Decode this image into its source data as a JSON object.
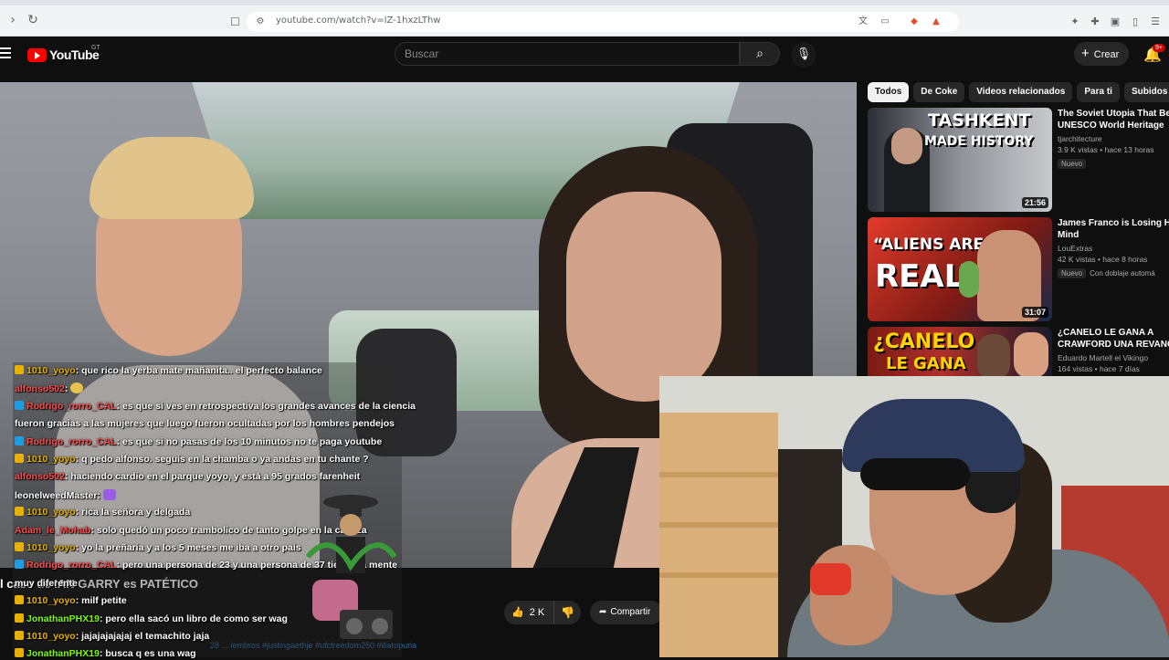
{
  "browser": {
    "url": "youtube.com/watch?v=lZ-1hxzLThw"
  },
  "header": {
    "logo_text": "YouTube",
    "logo_country": "GT",
    "search_placeholder": "Buscar",
    "create_label": "Crear",
    "notif_count": "9+"
  },
  "video": {
    "title": "l caso de IAN GARRY es PATÉTICO",
    "likes": "2 K",
    "share_label": "Compartir",
    "hashtags": "28 ... iembros #justingaethje #ufcfreedom250 #iliatopuria"
  },
  "chips": [
    "Todos",
    "De Coke",
    "Videos relacionados",
    "Para ti",
    "Subidos re"
  ],
  "recommendations": [
    {
      "title": "The Soviet Utopia That Beca",
      "title2": "UNESCO World Heritage",
      "channel": "tjarchitecture",
      "meta": "3.9 K vistas • hace 13 horas",
      "badge": "Nuevo",
      "duration": "21:56",
      "thumb_text1": "TASHKENT",
      "thumb_text2": "MADE HISTORY"
    },
    {
      "title": "James Franco is Losing His",
      "title2": "Mind",
      "channel": "LouExtras",
      "meta": "42 K vistas • hace 8 horas",
      "badge": "Nuevo",
      "extra": "Con doblaje automá",
      "duration": "31:07",
      "thumb_text1": "“ALIENS ARE",
      "thumb_text2": "REAL”"
    },
    {
      "title": "¿CANELO LE GANA A",
      "title2": "CRAWFORD UNA REVANCH",
      "channel": "Eduardo Martell el Vikingo",
      "meta": "164 vistas • hace 7 días",
      "thumb_text1": "¿CANELO",
      "thumb_text2": "LE GANA"
    }
  ],
  "chat": [
    {
      "user": "1010_yoyo",
      "msg": ": que rico la yerba mate mañanita.. el perfecto balance",
      "color": "#e8b100",
      "badge": "sub"
    },
    {
      "user": "alfonso502",
      "msg": ":",
      "color": "#ff4d4d",
      "badge": "none",
      "emote": "yellow"
    },
    {
      "user": "Rodrigo_rorro_CAL",
      "msg": ": es que si ves en retrospectiva los grandes avances de la ciencia",
      "color": "#ff4d4d",
      "badge": "tw"
    },
    {
      "user": "",
      "msg": "fueron gracias a las mujeres que luego fueron ocultadas por los hombres pendejos",
      "color": "#fff",
      "badge": "none"
    },
    {
      "user": "Rodrigo_rorro_CAL",
      "msg": ": es que si no pasas de los 10 minutos no te paga youtube",
      "color": "#ff4d4d",
      "badge": "tw"
    },
    {
      "user": "1010_yoyo",
      "msg": ": q pedo alfonso. seguis en la chamba o ya andas en tu chante ?",
      "color": "#e8b100",
      "badge": "sub"
    },
    {
      "user": "alfonso502",
      "msg": ": haciendo cardio en el parque yoyo, y está a 95 grados farenheit",
      "color": "#ff4d4d",
      "badge": "none"
    },
    {
      "user": "leonelweedMaster",
      "msg": ":",
      "color": "#ffffff",
      "badge": "none",
      "emote": "purple"
    },
    {
      "user": "1010_yoyo",
      "msg": ": rica la señora y delgada",
      "color": "#e8b100",
      "badge": "sub"
    },
    {
      "user": "Adam_le_Mohab",
      "msg": ": solo quedó un poco trambolico de tanto golpe en la cabeza",
      "color": "#ff4d4d",
      "badge": "none"
    },
    {
      "user": "1010_yoyo",
      "msg": ": yo la preñaria y a los 5 meses me iba a otro pais",
      "color": "#e8b100",
      "badge": "sub"
    },
    {
      "user": "Rodrigo_rorro_CAL",
      "msg": ": pero una persona de 23 y una persona de 37 tienen la mente",
      "color": "#ff4d4d",
      "badge": "tw"
    },
    {
      "user": "",
      "msg": "muy diferente",
      "color": "#fff",
      "badge": "none"
    },
    {
      "user": "1010_yoyo",
      "msg": ": milf petite",
      "color": "#e8b100",
      "badge": "sub"
    },
    {
      "user": "JonathanPHX19",
      "msg": ": pero ella sacó un libro de como ser wag",
      "color": "#7CFC00",
      "badge": "sub"
    },
    {
      "user": "1010_yoyo",
      "msg": ": jajajajajajaj el temachito jaja",
      "color": "#e8b100",
      "badge": "sub"
    },
    {
      "user": "JonathanPHX19",
      "msg": ": busca q es una wag",
      "color": "#7CFC00",
      "badge": "sub"
    }
  ],
  "colors": {
    "yt_red": "#ff0000",
    "chip_active": "#f1f1f1",
    "link_blue": "#3ea6ff"
  }
}
